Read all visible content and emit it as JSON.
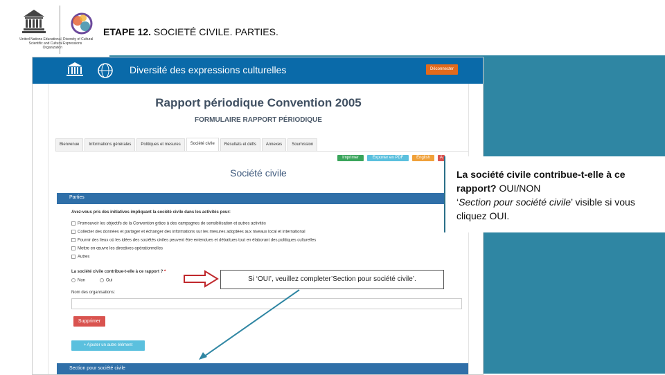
{
  "slide": {
    "step_label": "ETAPE 12.",
    "step_title": "SOCIETÉ CIVILE. PARTIES.",
    "unesco_caption": "United Nations Educational, Scientific and Cultural Organization",
    "convention_caption": "Diversity of Cultural Expressions"
  },
  "screenshot": {
    "header_title": "Diversité des expressions culturelles",
    "disconnect_label": "Déconnecter",
    "report_title": "Rapport périodique Convention 2005",
    "report_subtitle": "FORMULAIRE RAPPORT PÉRIODIQUE",
    "tabs": [
      {
        "label": "Bienvenue"
      },
      {
        "label": "Informations générales"
      },
      {
        "label": "Politiques et mesures"
      },
      {
        "label": "Société civile"
      },
      {
        "label": "Résultats et défis"
      },
      {
        "label": "Annexes"
      },
      {
        "label": "Soumission"
      }
    ],
    "action_buttons": {
      "print": "Imprimer",
      "export_pdf": "Exporter en PDF",
      "english": "English",
      "extra": "A"
    },
    "section_title": "Société civile",
    "panel_parties": "Parties",
    "question_initiatives": "Avez-vous pris des initiatives impliquant la société civile dans les activités pour:",
    "options": [
      "Promouvoir les objectifs de la Convention grâce à des campagnes de sensibilisation et autres activités",
      "Collecter des données et partager et échanger des informations sur les mesures adoptées aux niveaux local et international",
      "Fournir des lieux où les idées des sociétés civiles peuvent être entendues et débattues tout en élaborant des politiques culturelles",
      "Mettre en œuvre les directives opérationnelles",
      "Autres"
    ],
    "question_contribution": "La société civile contribue-t-elle à ce rapport ?",
    "required_mark": "*",
    "radio_no": "Non",
    "radio_yes": "Oui",
    "org_name_label": "Nom des organisations:",
    "delete_button": "Supprimer",
    "add_button": "+ Ajouter un autre élément",
    "panel_section_civil": "Section pour société civile"
  },
  "annotations": {
    "callout_text": "Si ‘OUI’, veuillez completer’Section pour société civile’.",
    "note_bold": "La société civile contribue-t-elle à ce rapport?",
    "note_rest1": " OUI/NON",
    "note_quote_open": "‘",
    "note_italic": "Section pour société civile",
    "note_rest2": "’ visible si vous cliquez OUI."
  },
  "colors": {
    "background_teal": "#2f86a3",
    "header_blue": "#0a6aa9",
    "panel_blue": "#2f6fa8",
    "arrow_red": "#c0282c",
    "arrow_teal": "#2f86a3"
  }
}
